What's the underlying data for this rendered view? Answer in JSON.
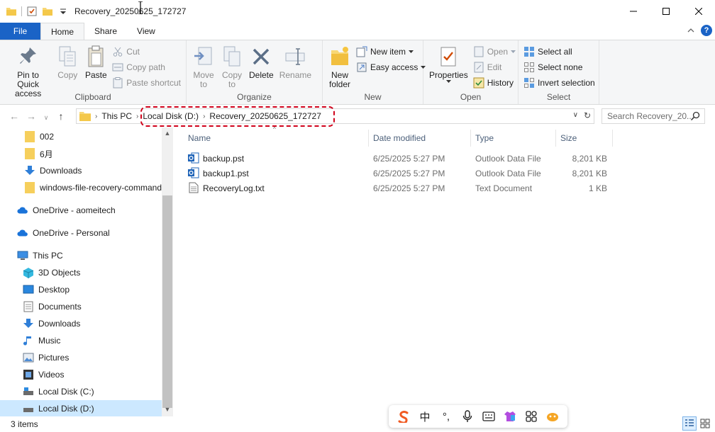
{
  "window": {
    "title": "Recovery_20250625_172727",
    "minimize_icon": "minimize-icon",
    "maximize_icon": "maximize-icon",
    "close_icon": "close-icon"
  },
  "tabs": [
    {
      "label": "File"
    },
    {
      "label": "Home"
    },
    {
      "label": "Share"
    },
    {
      "label": "View"
    }
  ],
  "ribbon": {
    "clipboard": {
      "label": "Clipboard",
      "pin_line1": "Pin to Quick",
      "pin_line2": "access",
      "copy": "Copy",
      "paste": "Paste",
      "cut": "Cut",
      "copy_path": "Copy path",
      "paste_shortcut": "Paste shortcut"
    },
    "organize": {
      "label": "Organize",
      "move_line1": "Move",
      "move_line2": "to",
      "copy_line1": "Copy",
      "copy_line2": "to",
      "delete": "Delete",
      "rename": "Rename"
    },
    "new": {
      "label": "New",
      "folder_line1": "New",
      "folder_line2": "folder",
      "new_item": "New item",
      "easy_access": "Easy access"
    },
    "open": {
      "label": "Open",
      "properties": "Properties",
      "open": "Open",
      "edit": "Edit",
      "history": "History"
    },
    "select": {
      "label": "Select",
      "select_all": "Select all",
      "select_none": "Select none",
      "invert": "Invert selection"
    }
  },
  "address": {
    "crumbs": [
      "This PC",
      "Local Disk (D:)",
      "Recovery_20250625_172727"
    ],
    "search_placeholder": "Search Recovery_20..."
  },
  "nav": {
    "items": [
      {
        "label": "002",
        "icon": "folder-icon"
      },
      {
        "label": "6月",
        "icon": "folder-icon"
      },
      {
        "label": "Downloads",
        "icon": "downloads-icon"
      },
      {
        "label": "windows-file-recovery-command",
        "icon": "folder-icon"
      },
      {
        "label": "OneDrive - aomeitech",
        "icon": "onedrive-icon"
      },
      {
        "label": "OneDrive - Personal",
        "icon": "onedrive-icon"
      },
      {
        "label": "This PC",
        "icon": "computer-icon"
      },
      {
        "label": "3D Objects",
        "icon": "3d-objects-icon"
      },
      {
        "label": "Desktop",
        "icon": "desktop-icon"
      },
      {
        "label": "Documents",
        "icon": "documents-icon"
      },
      {
        "label": "Downloads",
        "icon": "downloads-icon"
      },
      {
        "label": "Music",
        "icon": "music-icon"
      },
      {
        "label": "Pictures",
        "icon": "pictures-icon"
      },
      {
        "label": "Videos",
        "icon": "videos-icon"
      },
      {
        "label": "Local Disk (C:)",
        "icon": "drive-icon"
      },
      {
        "label": "Local Disk (D:)",
        "icon": "drive-icon"
      }
    ]
  },
  "files": {
    "columns": {
      "name": "Name",
      "date": "Date modified",
      "type": "Type",
      "size": "Size"
    },
    "rows": [
      {
        "name": "backup.pst",
        "date": "6/25/2025 5:27 PM",
        "type": "Outlook Data File",
        "size": "8,201 KB",
        "icon": "outlook-data-file-icon"
      },
      {
        "name": "backup1.pst",
        "date": "6/25/2025 5:27 PM",
        "type": "Outlook Data File",
        "size": "8,201 KB",
        "icon": "outlook-data-file-icon"
      },
      {
        "name": "RecoveryLog.txt",
        "date": "6/25/2025 5:27 PM",
        "type": "Text Document",
        "size": "1 KB",
        "icon": "text-document-icon"
      }
    ]
  },
  "status": {
    "count": "3 items"
  },
  "ime": {
    "lang": "中",
    "punct": "°,"
  },
  "colors": {
    "accent": "#1a63c6",
    "highlight": "#d0021b",
    "selected": "#cce8ff"
  }
}
